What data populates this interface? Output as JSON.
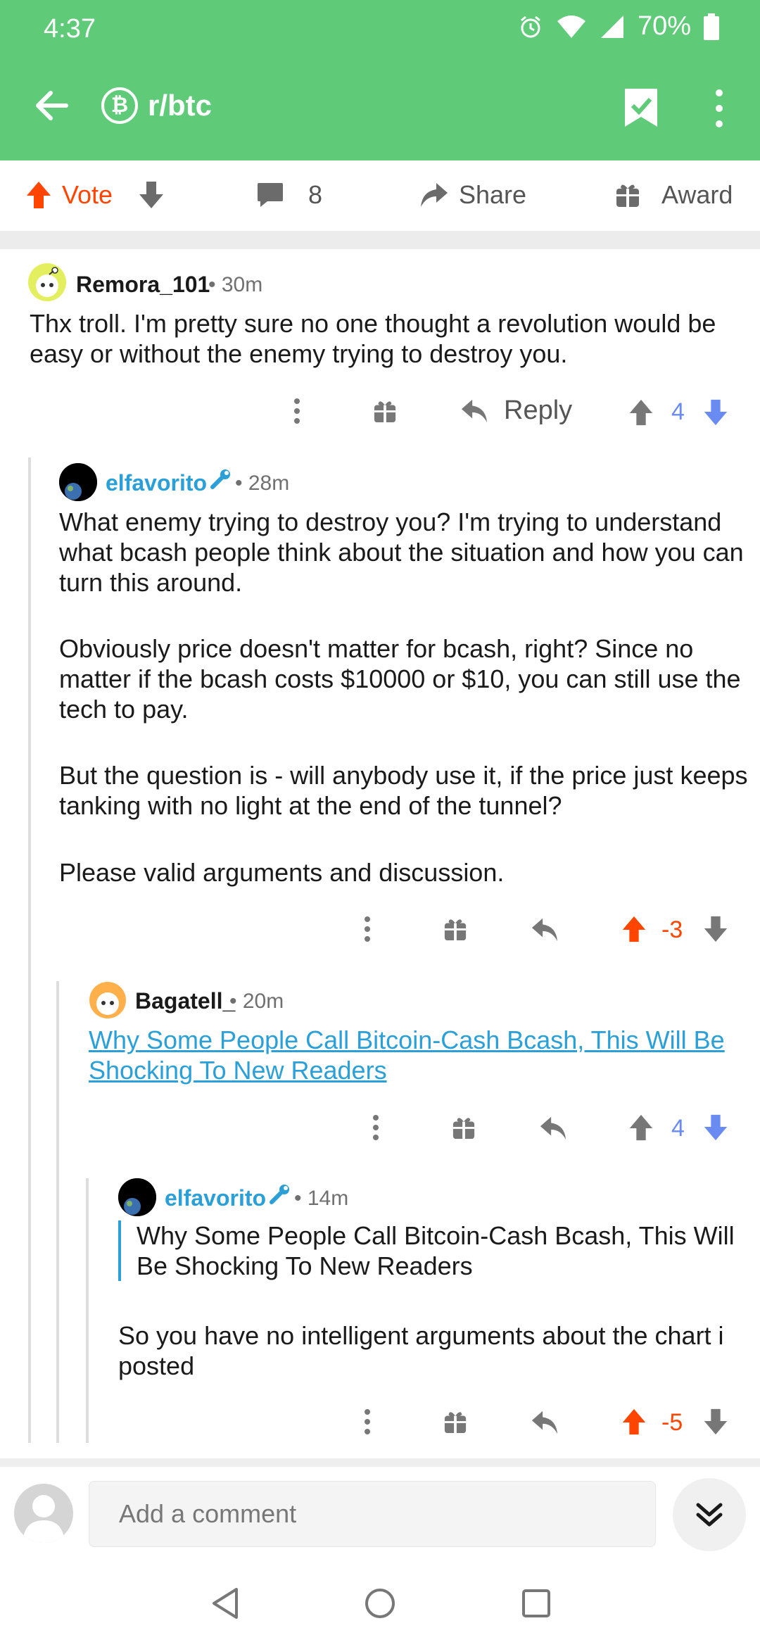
{
  "status": {
    "time": "4:37",
    "battery": "70%"
  },
  "header": {
    "subreddit": "r/btc",
    "badge": "₿"
  },
  "post_actions": {
    "vote_label": "Vote",
    "comment_count": "8",
    "share_label": "Share",
    "award_label": "Award"
  },
  "comments": [
    {
      "user": "Remora_101",
      "age": "• 30m",
      "body": "Thx troll. I'm pretty sure no one thought a revolution would be easy or without the enemy trying to destroy you.",
      "reply_label": "Reply",
      "score": "4"
    },
    {
      "user": "elfavorito",
      "age": "• 28m",
      "paragraphs": [
        "What enemy trying to destroy you? I'm trying to understand what bcash people think about the situation and how you can turn this around.",
        "Obviously price doesn't matter for bcash, right? Since no matter if the bcash costs $10000 or $10, you can still use the tech to pay.",
        "But the question is - will anybody use it, if the price just keeps tanking with no light at the end of the tunnel?",
        "Please valid arguments and discussion."
      ],
      "score": "-3"
    },
    {
      "user": "Bagatell_",
      "age": "• 20m",
      "link": "Why Some People Call Bitcoin-Cash Bcash, This Will Be Shocking To New Readers",
      "score": "4"
    },
    {
      "user": "elfavorito",
      "age": "• 14m",
      "quote": "Why Some People Call Bitcoin-Cash Bcash, This Will Be Shocking To New Readers",
      "body": "So you have no intelligent arguments about the chart i posted",
      "score": "-5"
    }
  ],
  "composer": {
    "placeholder": "Add a comment"
  },
  "colors": {
    "accent": "#5fcb78",
    "upvote": "#ff4500",
    "downvote": "#6a8bf2",
    "link": "#2a9fd8"
  }
}
